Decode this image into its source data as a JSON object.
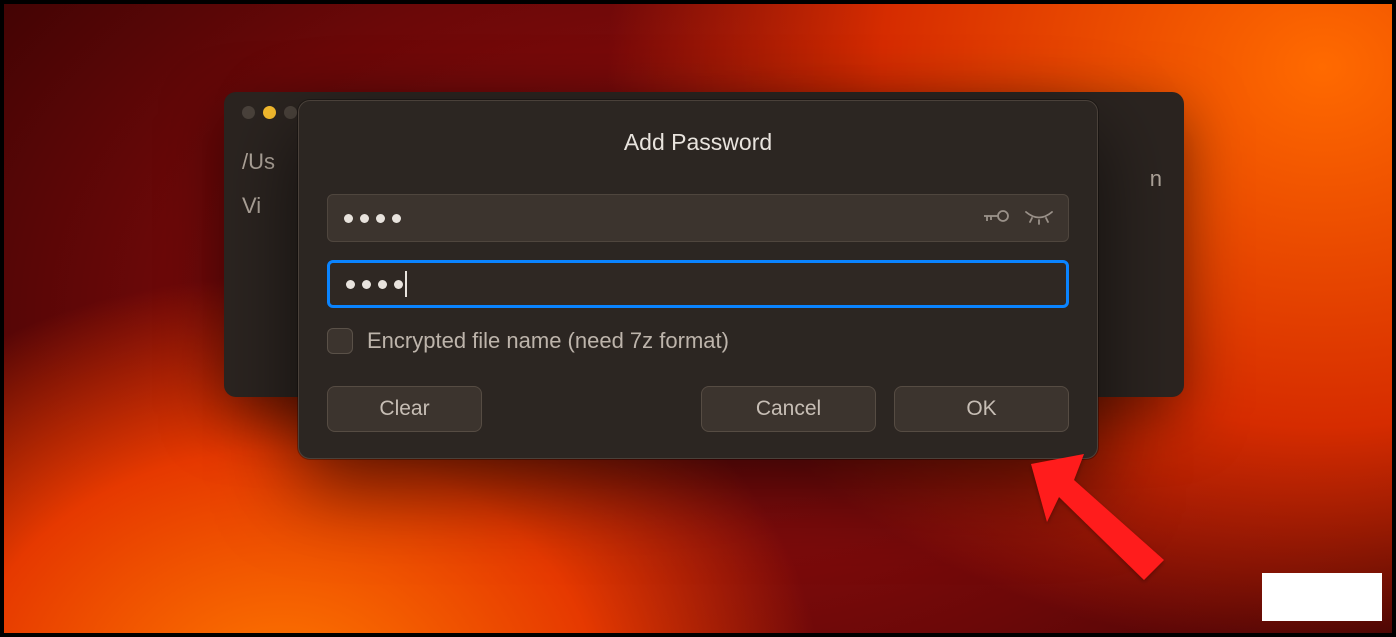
{
  "modal": {
    "title": "Add Password",
    "password1_value": "••••",
    "password2_value": "••••",
    "encrypt_label": "Encrypted file name (need 7z format)",
    "encrypt_checked": false,
    "buttons": {
      "clear": "Clear",
      "cancel": "Cancel",
      "ok": "OK"
    }
  },
  "parent": {
    "path_prefix": "/Us",
    "size_label": "Vi",
    "trailing": "n"
  }
}
